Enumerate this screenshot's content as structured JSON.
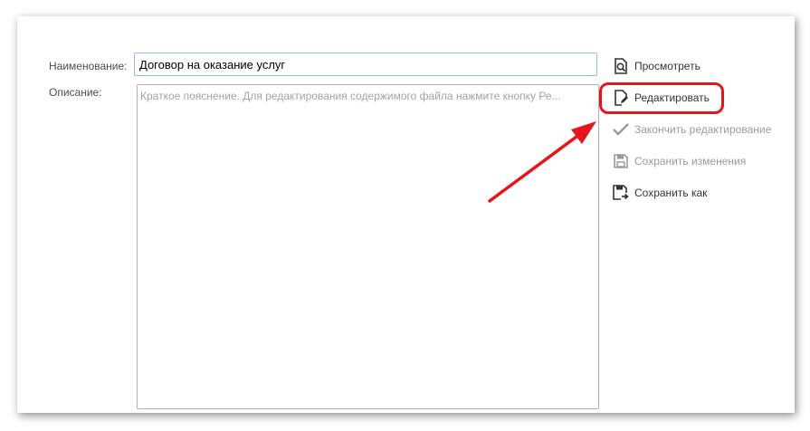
{
  "form": {
    "name_label": "Наименование:",
    "name_value": "Договор на оказание услуг",
    "description_label": "Описание:",
    "description_placeholder": "Краткое пояснение. Для редактирования содержимого файла нажмите кнопку Ре..."
  },
  "commands": {
    "view": {
      "label": "Просмотреть",
      "icon": "view-file-icon"
    },
    "edit": {
      "label": "Редактировать",
      "icon": "edit-file-icon"
    },
    "finish_edit": {
      "label": "Закончить редактирование",
      "icon": "checkmark-icon",
      "enabled": false
    },
    "save_changes": {
      "label": "Сохранить изменения",
      "icon": "save-icon",
      "enabled": false
    },
    "save_as": {
      "label": "Сохранить как",
      "icon": "save-as-icon"
    }
  },
  "annotation": {
    "highlight_color": "#e8141c",
    "highlight_target": "edit"
  }
}
